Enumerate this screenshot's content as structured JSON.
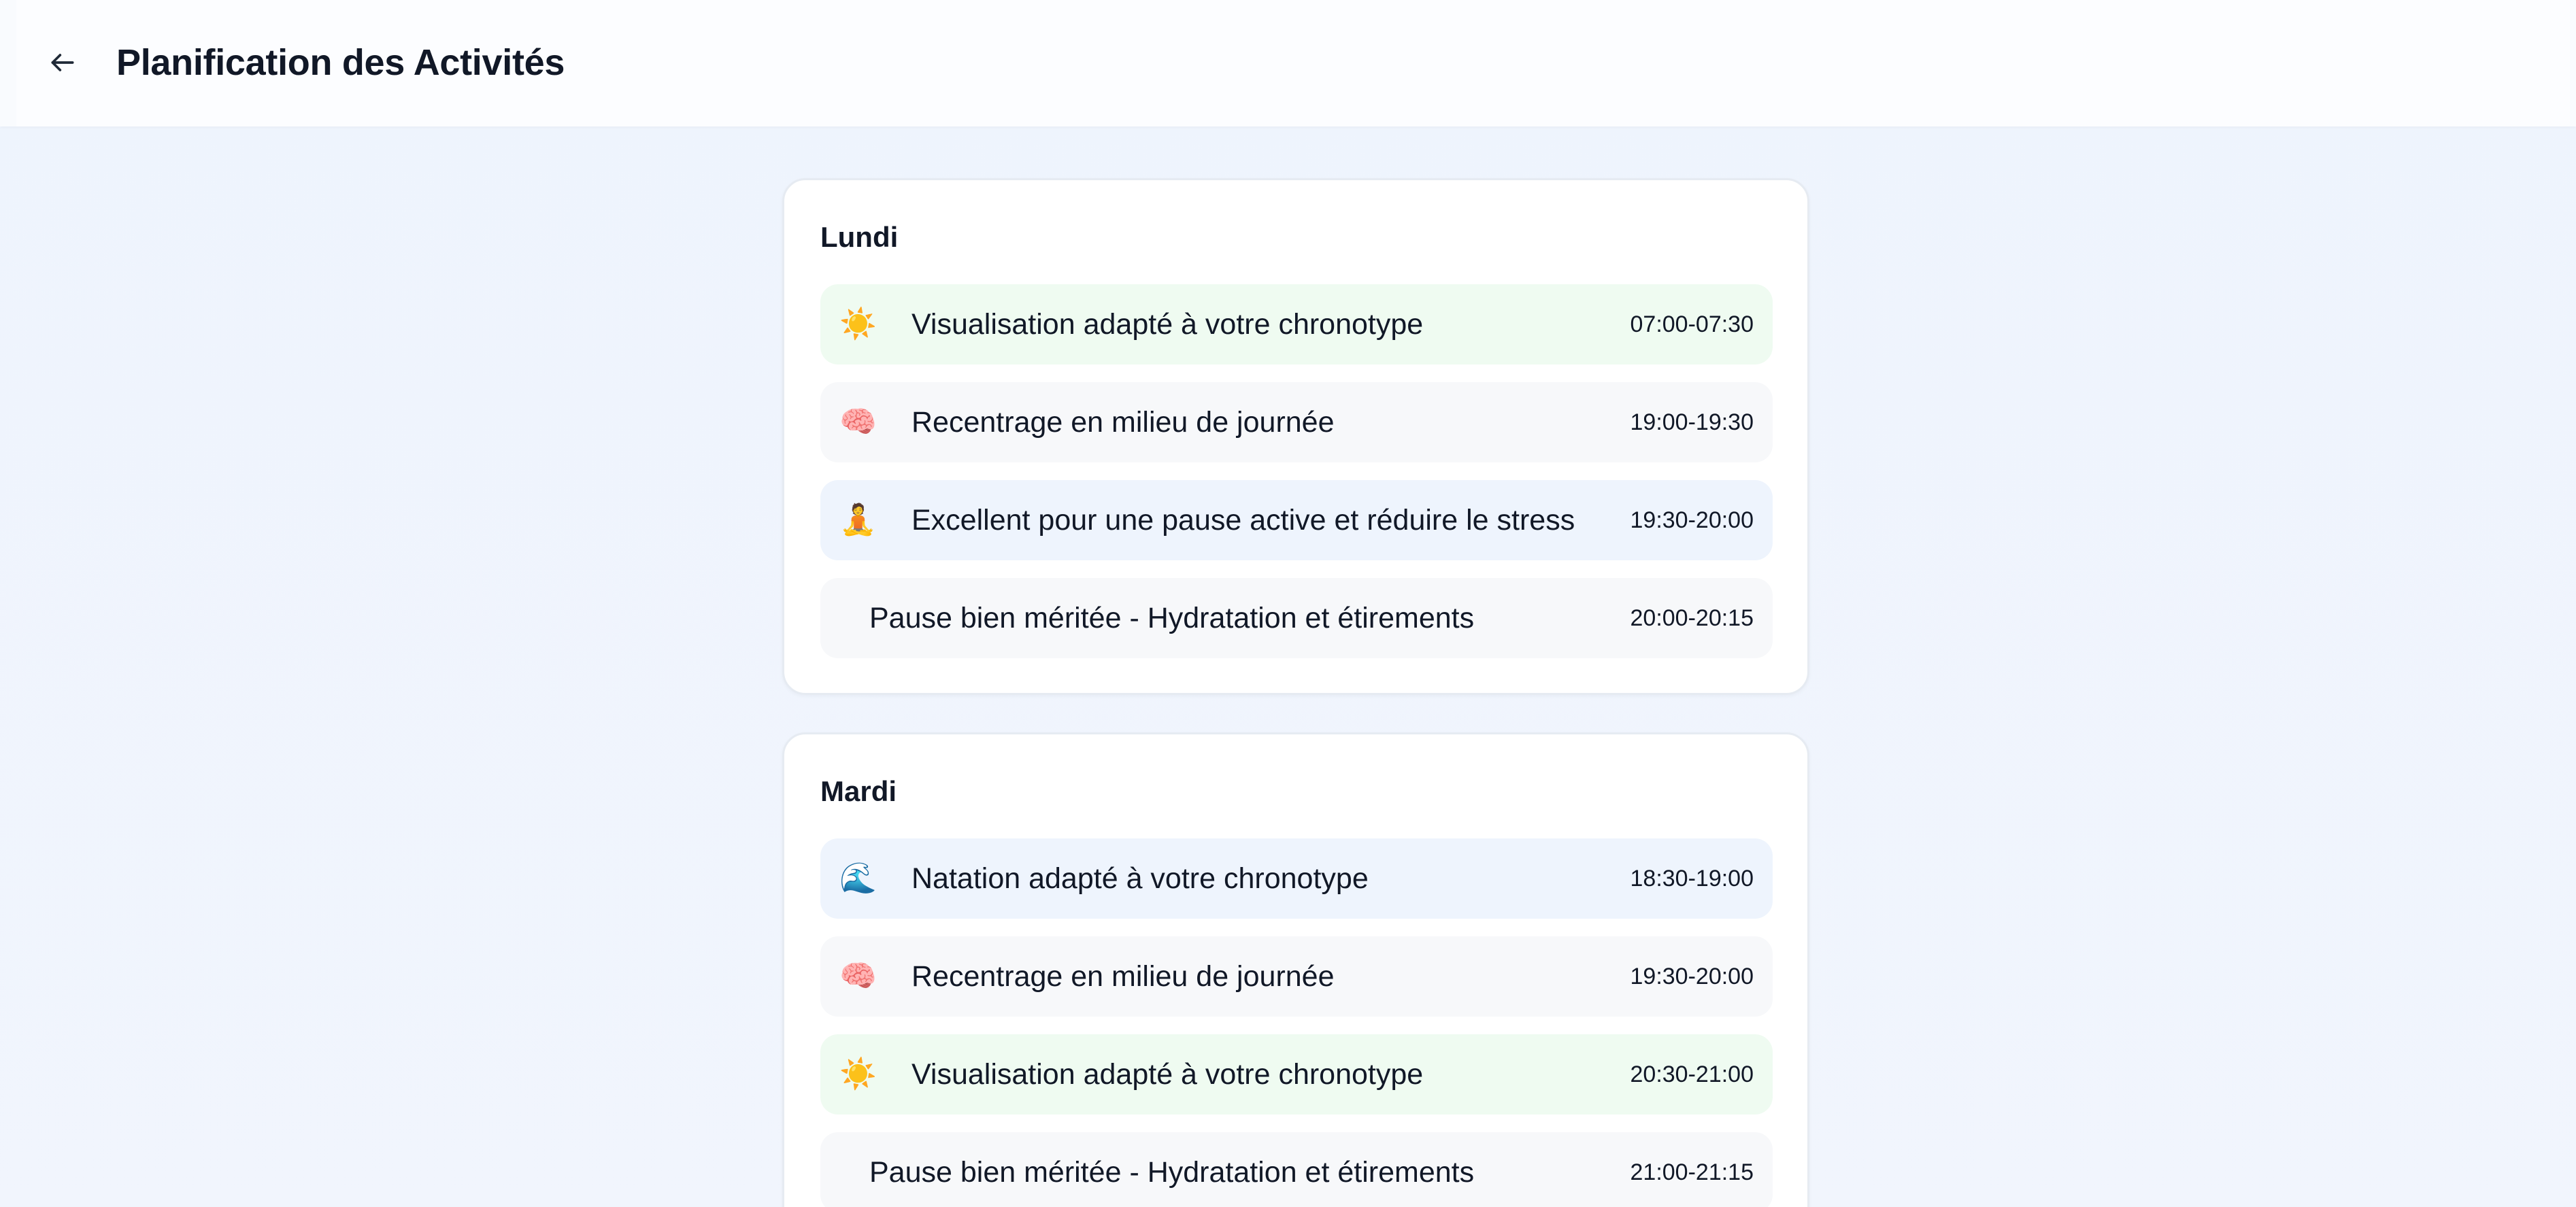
{
  "header": {
    "title": "Planification des Activités",
    "back_icon": "arrow-left-icon"
  },
  "days": [
    {
      "name": "Lundi",
      "activities": [
        {
          "icon": "☀️",
          "icon_name": "sun-icon",
          "label": "Visualisation adapté à votre chronotype",
          "time": "07:00-07:30",
          "color": "green"
        },
        {
          "icon": "🧠",
          "icon_name": "brain-icon",
          "label": "Recentrage en milieu de journée",
          "time": "19:00-19:30",
          "color": "gray"
        },
        {
          "icon": "🧘",
          "icon_name": "meditation-icon",
          "label": "Excellent pour une pause active et réduire le stress",
          "time": "19:30-20:00",
          "color": "blue"
        },
        {
          "icon": "",
          "icon_name": "",
          "label": "Pause bien méritée - Hydratation et étirements",
          "time": "20:00-20:15",
          "color": "gray"
        }
      ]
    },
    {
      "name": "Mardi",
      "activities": [
        {
          "icon": "🌊",
          "icon_name": "swimming-icon",
          "label": "Natation adapté à votre chronotype",
          "time": "18:30-19:00",
          "color": "blue"
        },
        {
          "icon": "🧠",
          "icon_name": "brain-icon",
          "label": "Recentrage en milieu de journée",
          "time": "19:30-20:00",
          "color": "gray"
        },
        {
          "icon": "☀️",
          "icon_name": "sun-icon",
          "label": "Visualisation adapté à votre chronotype",
          "time": "20:30-21:00",
          "color": "green"
        },
        {
          "icon": "",
          "icon_name": "",
          "label": "Pause bien méritée - Hydratation et étirements",
          "time": "21:00-21:15",
          "color": "gray"
        }
      ]
    }
  ],
  "colors": {
    "green": "#effbf1",
    "blue": "#eef4fd",
    "gray": "#f7f8fa",
    "background": "#eef4fd"
  }
}
